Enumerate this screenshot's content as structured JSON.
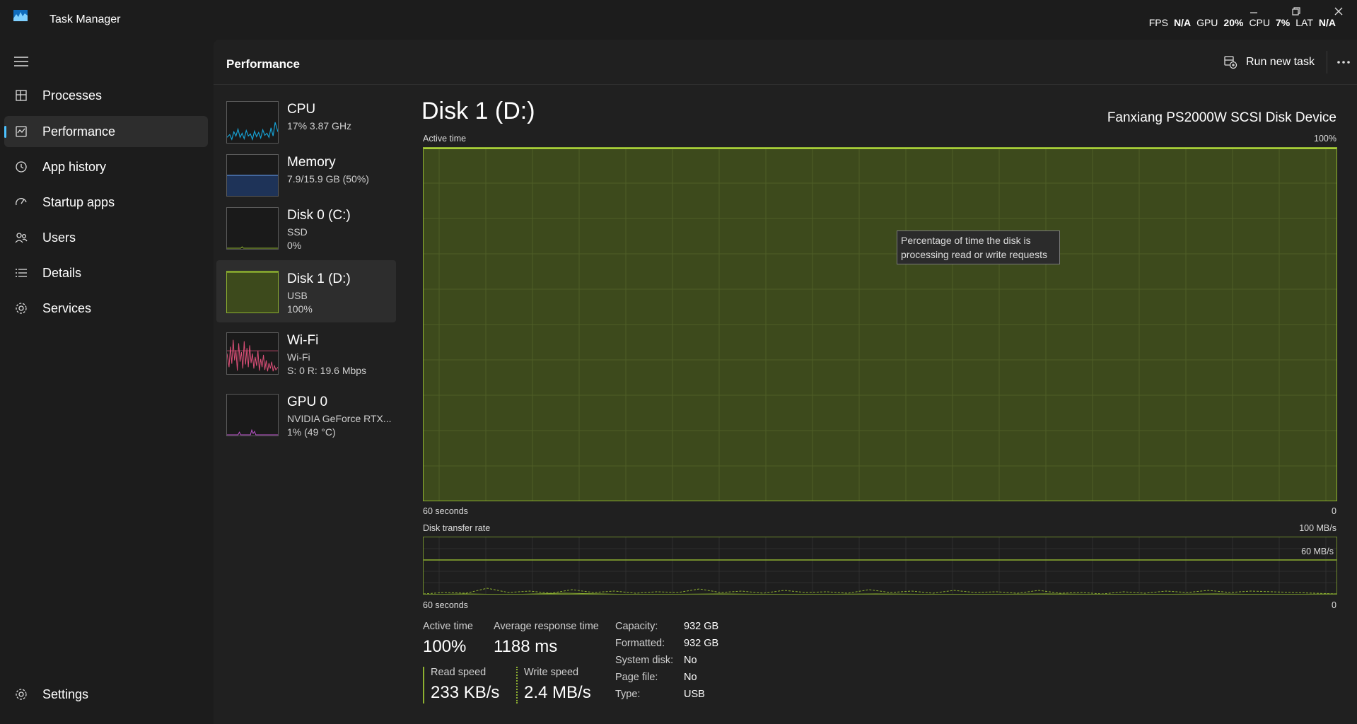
{
  "window": {
    "title": "Task Manager",
    "overlay": {
      "fps_label": "FPS",
      "fps_value": "N/A",
      "gpu_label": "GPU",
      "gpu_value": "20%",
      "cpu_label": "CPU",
      "cpu_value": "7%",
      "lat_label": "LAT",
      "lat_value": "N/A"
    }
  },
  "nav": {
    "items": [
      {
        "label": "Processes",
        "icon": "processes-icon"
      },
      {
        "label": "Performance",
        "icon": "performance-icon",
        "active": true
      },
      {
        "label": "App history",
        "icon": "history-icon"
      },
      {
        "label": "Startup apps",
        "icon": "startup-icon"
      },
      {
        "label": "Users",
        "icon": "users-icon"
      },
      {
        "label": "Details",
        "icon": "details-icon"
      },
      {
        "label": "Services",
        "icon": "services-icon"
      }
    ],
    "settings_label": "Settings"
  },
  "header": {
    "title": "Performance",
    "run_task_label": "Run new task"
  },
  "devices": [
    {
      "title": "CPU",
      "sub1": "17%  3.87 GHz",
      "sub2": ""
    },
    {
      "title": "Memory",
      "sub1": "7.9/15.9 GB (50%)",
      "sub2": ""
    },
    {
      "title": "Disk 0 (C:)",
      "sub1": "SSD",
      "sub2": "0%"
    },
    {
      "title": "Disk 1 (D:)",
      "sub1": "USB",
      "sub2": "100%"
    },
    {
      "title": "Wi-Fi",
      "sub1": "Wi-Fi",
      "sub2": "S: 0  R: 19.6 Mbps"
    },
    {
      "title": "GPU 0",
      "sub1": "NVIDIA GeForce RTX...",
      "sub2": "1%  (49 °C)"
    }
  ],
  "detail": {
    "title": "Disk 1 (D:)",
    "device_name": "Fanxiang PS2000W SCSI Disk Device",
    "active_graph": {
      "label": "Active time",
      "max_label": "100%",
      "x_left": "60 seconds",
      "x_right": "0",
      "value_percent": 100,
      "tooltip": "Percentage of time the disk is processing read or write requests"
    },
    "transfer_graph": {
      "label": "Disk transfer rate",
      "max_label": "100 MB/s",
      "ref_label": "60 MB/s",
      "x_left": "60 seconds",
      "x_right": "0"
    },
    "stats": {
      "active_time_label": "Active time",
      "active_time_value": "100%",
      "avg_response_label": "Average response time",
      "avg_response_value": "1188 ms",
      "read_speed_label": "Read speed",
      "read_speed_value": "233 KB/s",
      "write_speed_label": "Write speed",
      "write_speed_value": "2.4 MB/s"
    },
    "properties": [
      {
        "key": "Capacity:",
        "value": "932 GB"
      },
      {
        "key": "Formatted:",
        "value": "932 GB"
      },
      {
        "key": "System disk:",
        "value": "No"
      },
      {
        "key": "Page file:",
        "value": "No"
      },
      {
        "key": "Type:",
        "value": "USB"
      }
    ]
  },
  "colors": {
    "accent": "#4cc2ff",
    "disk": "#8db030",
    "cpu": "#17a3d6",
    "memory": "#5a8ad0",
    "wifi": "#e0507a",
    "gpu": "#c056d0"
  }
}
